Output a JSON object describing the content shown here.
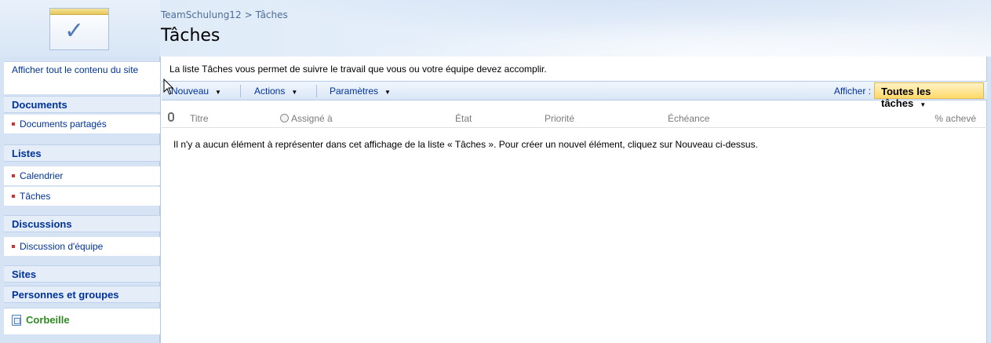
{
  "header": {
    "breadcrumb": [
      "TeamSchulung12",
      "Tâches"
    ],
    "breadcrumb_sep": ">",
    "title": "Tâches"
  },
  "quicklaunch": {
    "view_all": "Afficher tout le contenu du site",
    "sections": {
      "documents": "Documents",
      "listes": "Listes",
      "discussions": "Discussions",
      "sites": "Sites",
      "personnes": "Personnes et groupes"
    },
    "items": {
      "documents_partages": "Documents partagés",
      "calendrier": "Calendrier",
      "taches": "Tâches",
      "discussion_equipe": "Discussion d'équipe"
    },
    "recycle": "Corbeille",
    "bullet_color": "#cc3333",
    "link_color": "#003399",
    "recycle_color": "#2e8b22"
  },
  "main": {
    "description": "La liste Tâches vous permet de suivre le travail que vous ou votre équipe devez accomplir.",
    "toolbar": {
      "new": "Nouveau",
      "actions": "Actions",
      "settings": "Paramètres",
      "view_label": "Afficher :",
      "view_value": "Toutes les tâches"
    },
    "columns": {
      "title": "Titre",
      "assigned": "Assigné à",
      "status": "État",
      "priority": "Priorité",
      "due": "Échéance",
      "complete": "% achevé"
    },
    "empty_message": "Il n'y a aucun élément à représenter dans cet affichage de la liste « Tâches ». Pour créer un nouvel élément, cliquez sur Nouveau ci-dessus."
  },
  "icons": {
    "logo": "tasks-check-icon",
    "attachment": "paperclip-icon",
    "assigned": "presence-icon",
    "recycle": "recycle-bin-icon",
    "cursor": "mouse-pointer-icon"
  },
  "colors": {
    "view_select_bg": "#ffd96b",
    "toolbar_bg": "#d9e6f7",
    "quicklaunch_bg": "#d6e3f5"
  }
}
